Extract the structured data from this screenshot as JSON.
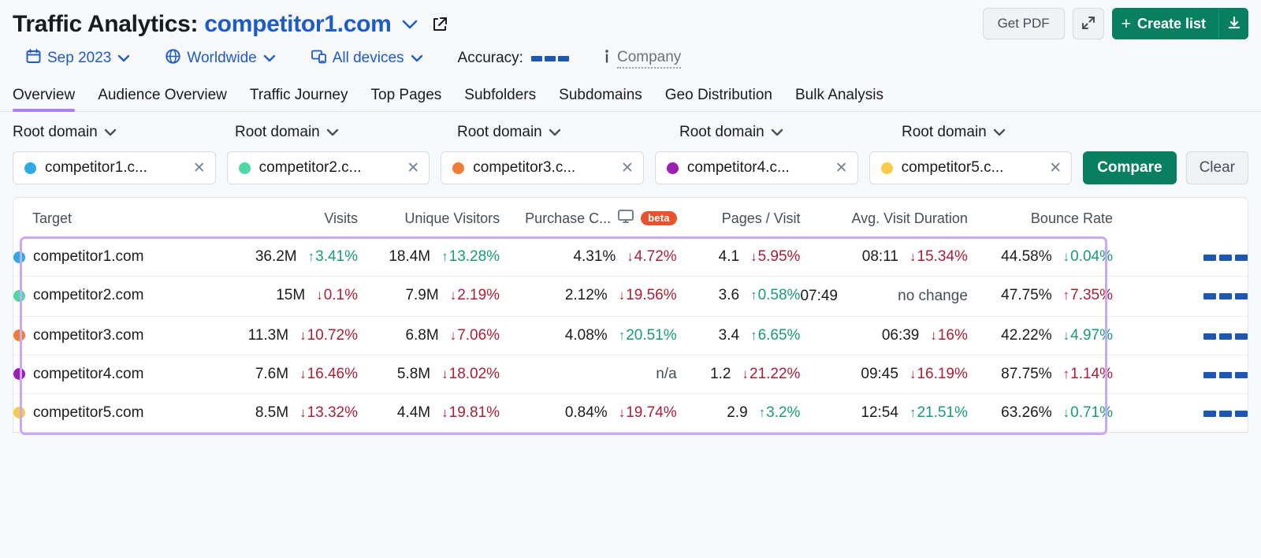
{
  "header": {
    "title_prefix": "Traffic Analytics:",
    "domain": "competitor1.com",
    "caret": "˅",
    "external_link_icon": "external-link-icon"
  },
  "header_actions": {
    "get_pdf": "Get PDF",
    "expand_icon": "expand-icon",
    "create_list": "Create list",
    "plus": "+",
    "download_icon": "download-icon"
  },
  "filters": {
    "date": "Sep 2023",
    "location": "Worldwide",
    "device": "All devices",
    "accuracy_label": "Accuracy:",
    "company_label": "Company",
    "info_icon": "info-icon",
    "caret": "˅"
  },
  "tabs": [
    {
      "label": "Overview",
      "active": true
    },
    {
      "label": "Audience Overview",
      "active": false
    },
    {
      "label": "Traffic Journey",
      "active": false
    },
    {
      "label": "Top Pages",
      "active": false
    },
    {
      "label": "Subfolders",
      "active": false
    },
    {
      "label": "Subdomains",
      "active": false
    },
    {
      "label": "Geo Distribution",
      "active": false
    },
    {
      "label": "Bulk Analysis",
      "active": false
    }
  ],
  "selector": {
    "root_domain_label": "Root domain",
    "caret": "˅",
    "compare_label": "Compare",
    "clear_label": "Clear",
    "close_glyph": "✕",
    "chips": [
      {
        "label": "competitor1.c...",
        "color": "#2eaae2"
      },
      {
        "label": "competitor2.c...",
        "color": "#4fd7a5"
      },
      {
        "label": "competitor3.c...",
        "color": "#ef7e34"
      },
      {
        "label": "competitor4.c...",
        "color": "#9b1fb5"
      },
      {
        "label": "competitor5.c...",
        "color": "#f7ca49"
      }
    ]
  },
  "table": {
    "columns": {
      "target": "Target",
      "visits": "Visits",
      "unique_visitors": "Unique Visitors",
      "purchase_conversion": "Purchase C...",
      "purchase_conversion_icon": "desktop-icon",
      "beta": "beta",
      "pages_per_visit": "Pages / Visit",
      "avg_visit_duration": "Avg. Visit Duration",
      "bounce_rate": "Bounce Rate",
      "sparkline": ""
    },
    "rows": [
      {
        "target": "competitor1.com",
        "color": "#2eaae2",
        "visits": {
          "value": "36.2M",
          "delta": "3.41%",
          "dir": "up",
          "tone": "good"
        },
        "unique_visitors": {
          "value": "18.4M",
          "delta": "13.28%",
          "dir": "up",
          "tone": "good"
        },
        "purchase_conversion": {
          "value": "4.31%",
          "delta": "4.72%",
          "dir": "down",
          "tone": "bad"
        },
        "pages_per_visit": {
          "value": "4.1",
          "delta": "5.95%",
          "dir": "down",
          "tone": "bad"
        },
        "avg_visit_duration": {
          "value": "08:11",
          "delta": "15.34%",
          "dir": "down",
          "tone": "bad"
        },
        "bounce_rate": {
          "value": "44.58%",
          "delta": "0.04%",
          "dir": "down",
          "tone": "good"
        }
      },
      {
        "target": "competitor2.com",
        "color": "#4fd7a5",
        "visits": {
          "value": "15M",
          "delta": "0.1%",
          "dir": "down",
          "tone": "bad"
        },
        "unique_visitors": {
          "value": "7.9M",
          "delta": "2.19%",
          "dir": "down",
          "tone": "bad"
        },
        "purchase_conversion": {
          "value": "2.12%",
          "delta": "19.56%",
          "dir": "down",
          "tone": "bad"
        },
        "pages_per_visit": {
          "value": "3.6",
          "delta": "0.58%",
          "dir": "up",
          "tone": "good"
        },
        "avg_visit_duration": {
          "value": "07:49",
          "delta": "no change",
          "dir": "none",
          "tone": "neutral"
        },
        "bounce_rate": {
          "value": "47.75%",
          "delta": "7.35%",
          "dir": "up",
          "tone": "bad"
        }
      },
      {
        "target": "competitor3.com",
        "color": "#ef7e34",
        "visits": {
          "value": "11.3M",
          "delta": "10.72%",
          "dir": "down",
          "tone": "bad"
        },
        "unique_visitors": {
          "value": "6.8M",
          "delta": "7.06%",
          "dir": "down",
          "tone": "bad"
        },
        "purchase_conversion": {
          "value": "4.08%",
          "delta": "20.51%",
          "dir": "up",
          "tone": "good"
        },
        "pages_per_visit": {
          "value": "3.4",
          "delta": "6.65%",
          "dir": "up",
          "tone": "good"
        },
        "avg_visit_duration": {
          "value": "06:39",
          "delta": "16%",
          "dir": "down",
          "tone": "bad"
        },
        "bounce_rate": {
          "value": "42.22%",
          "delta": "4.97%",
          "dir": "down",
          "tone": "good"
        }
      },
      {
        "target": "competitor4.com",
        "color": "#9b1fb5",
        "visits": {
          "value": "7.6M",
          "delta": "16.46%",
          "dir": "down",
          "tone": "bad"
        },
        "unique_visitors": {
          "value": "5.8M",
          "delta": "18.02%",
          "dir": "down",
          "tone": "bad"
        },
        "purchase_conversion": {
          "value": "n/a",
          "delta": "",
          "dir": "none",
          "tone": "neutral"
        },
        "pages_per_visit": {
          "value": "1.2",
          "delta": "21.22%",
          "dir": "down",
          "tone": "bad"
        },
        "avg_visit_duration": {
          "value": "09:45",
          "delta": "16.19%",
          "dir": "down",
          "tone": "bad"
        },
        "bounce_rate": {
          "value": "87.75%",
          "delta": "1.14%",
          "dir": "up",
          "tone": "bad"
        }
      },
      {
        "target": "competitor5.com",
        "color": "#f7ca49",
        "visits": {
          "value": "8.5M",
          "delta": "13.32%",
          "dir": "down",
          "tone": "bad"
        },
        "unique_visitors": {
          "value": "4.4M",
          "delta": "19.81%",
          "dir": "down",
          "tone": "bad"
        },
        "purchase_conversion": {
          "value": "0.84%",
          "delta": "19.74%",
          "dir": "down",
          "tone": "bad"
        },
        "pages_per_visit": {
          "value": "2.9",
          "delta": "3.2%",
          "dir": "up",
          "tone": "good"
        },
        "avg_visit_duration": {
          "value": "12:54",
          "delta": "21.51%",
          "dir": "up",
          "tone": "good"
        },
        "bounce_rate": {
          "value": "63.26%",
          "delta": "0.71%",
          "dir": "down",
          "tone": "good"
        }
      }
    ]
  },
  "colors": {
    "brand_green": "#088060",
    "link_blue": "#1e5bc6",
    "accent_purple": "#ab80f5",
    "highlight_purple": "#c8a8f7",
    "positive": "#179b77",
    "negative": "#ab1f35",
    "beta_orange": "#e8532e"
  }
}
